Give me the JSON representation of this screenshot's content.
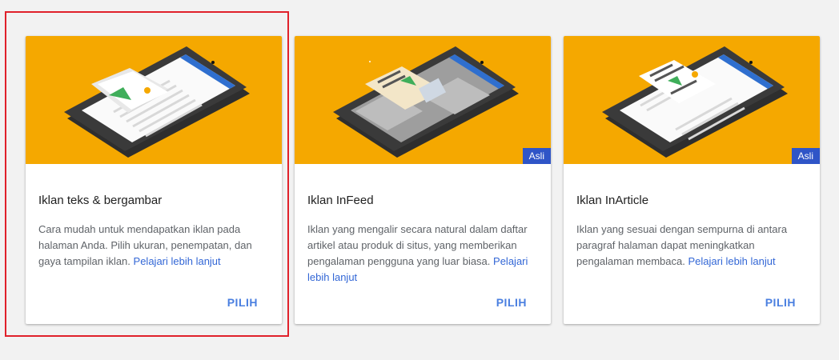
{
  "colors": {
    "hero_background": "#f5a800",
    "badge_background": "#2f55c7",
    "link": "#3367d6",
    "action": "#4a7fe0",
    "highlight_border": "#e0212b"
  },
  "cards": [
    {
      "illustration": "phone-with-image-ad-icon",
      "title": "Iklan teks & bergambar",
      "description": "Cara mudah untuk mendapatkan iklan pada halaman Anda. Pilih ukuran, penempatan, dan gaya tampilan iklan.",
      "learn_more": "Pelajari lebih lanjut",
      "select_label": "PILIH"
    },
    {
      "illustration": "phone-with-infeed-ad-icon",
      "badge": "Asli",
      "title": "Iklan InFeed",
      "description": "Iklan yang mengalir secara natural dalam daftar artikel atau produk di situs, yang memberikan pengalaman pengguna yang luar biasa.",
      "learn_more": "Pelajari lebih lanjut",
      "select_label": "PILIH"
    },
    {
      "illustration": "phone-with-inarticle-ad-icon",
      "badge": "Asli",
      "title": "Iklan InArticle",
      "description": "Iklan yang sesuai dengan sempurna di antara paragraf halaman dapat meningkatkan pengalaman membaca.",
      "learn_more": "Pelajari lebih lanjut",
      "select_label": "PILIH"
    }
  ]
}
